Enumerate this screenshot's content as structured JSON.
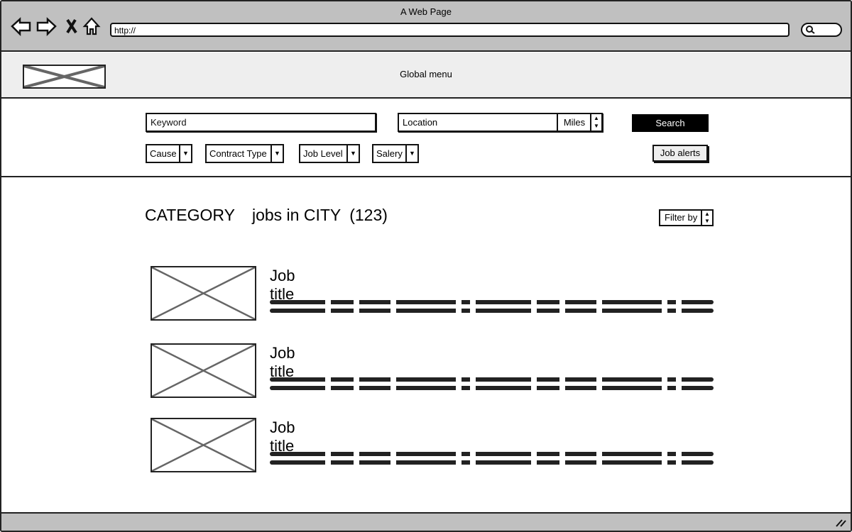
{
  "browser": {
    "title": "A Web Page",
    "url": "http://",
    "icons": [
      "back-arrow-icon",
      "forward-arrow-icon",
      "close-icon",
      "home-icon",
      "search-icon"
    ]
  },
  "header": {
    "global_menu": "Global menu"
  },
  "search": {
    "keyword_placeholder": "Keyword",
    "location_placeholder": "Location",
    "distance_unit": "Miles",
    "search_label": "Search",
    "job_alerts_label": "Job alerts",
    "filters": [
      {
        "label": "Cause"
      },
      {
        "label": "Contract Type"
      },
      {
        "label": "Job Level"
      },
      {
        "label": "Salery"
      }
    ]
  },
  "results": {
    "category": "CATEGORY",
    "location_text": "jobs in CITY",
    "count": "(123)",
    "filter_label": "Filter by",
    "jobs": [
      {
        "title": "Job title"
      },
      {
        "title": "Job title"
      },
      {
        "title": "Job title"
      }
    ]
  }
}
